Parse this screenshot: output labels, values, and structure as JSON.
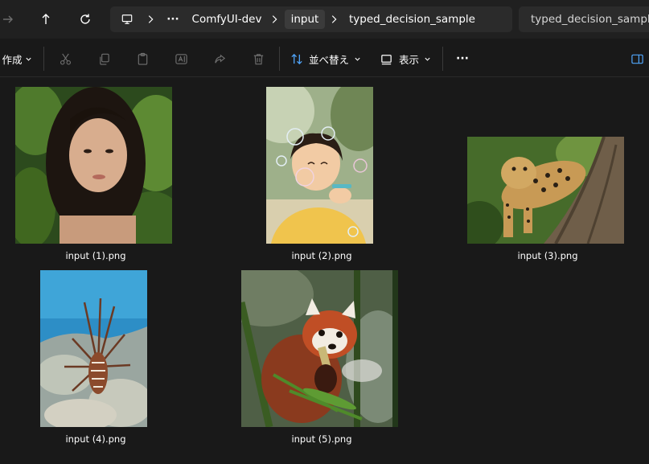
{
  "address_bar": {
    "breadcrumbs": [
      "ComfyUI-dev",
      "input",
      "typed_decision_sample"
    ],
    "more_label": "···",
    "search_text": "typed_decision_sample"
  },
  "toolbar": {
    "new_label": "作成",
    "sort_label": "並べ替え",
    "view_label": "表示",
    "more_label": "···"
  },
  "files": [
    {
      "name": "input (1).png",
      "subject": "portrait of a woman among leaves"
    },
    {
      "name": "input (2).png",
      "subject": "child blowing soap bubbles"
    },
    {
      "name": "input (3).png",
      "subject": "leopard on a tree"
    },
    {
      "name": "input (4).png",
      "subject": "lionfish on coral reef"
    },
    {
      "name": "input (5).png",
      "subject": "red panda eating bamboo"
    }
  ],
  "colors": {
    "background": "#191919",
    "bar": "#202020",
    "field": "#2b2b2b",
    "text": "#ffffff"
  },
  "icons": [
    "forward-arrow-icon",
    "up-arrow-icon",
    "refresh-icon",
    "monitor-icon",
    "chevron-right-icon",
    "chevron-down-icon",
    "cut-icon",
    "copy-icon",
    "paste-icon",
    "rename-icon",
    "share-icon",
    "delete-icon",
    "sort-icon",
    "view-icon",
    "details-pane-icon"
  ]
}
